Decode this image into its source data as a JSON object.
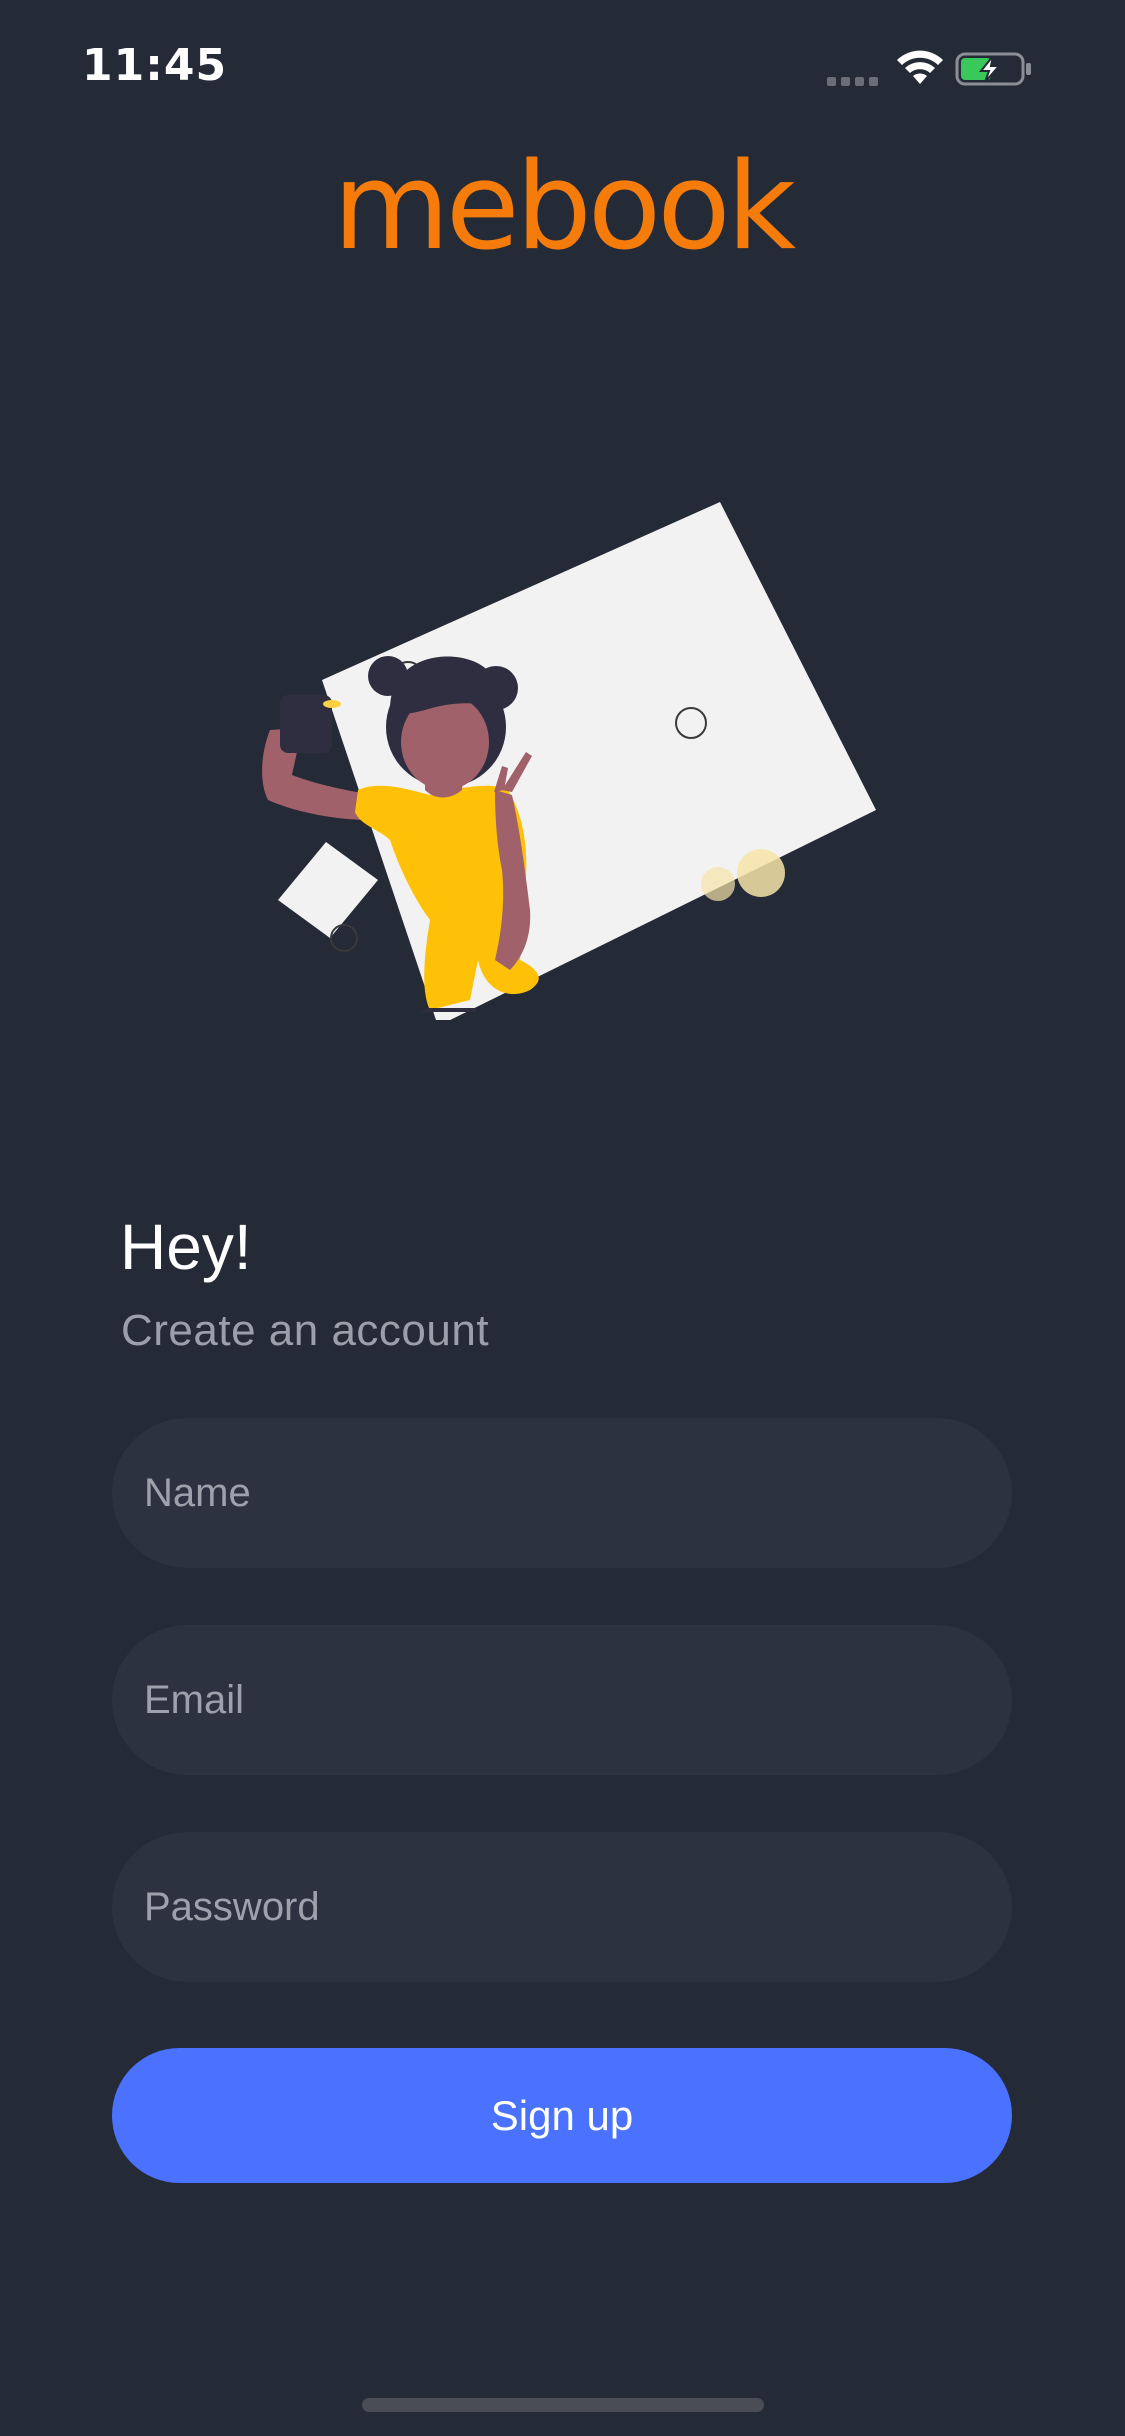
{
  "status_bar": {
    "time": "11:45",
    "icons": [
      "signal-dots-icon",
      "wifi-icon",
      "battery-charging-icon"
    ]
  },
  "brand": {
    "logo_text": "mebook",
    "color": "#f57c0b"
  },
  "illustration": {
    "description_icon": "selfie-illustration"
  },
  "greeting": {
    "title": "Hey!",
    "subtitle": "Create an account"
  },
  "form": {
    "name_placeholder": "Name",
    "email_placeholder": "Email",
    "password_placeholder": "Password",
    "name_value": "",
    "email_value": "",
    "password_value": "",
    "submit_label": "Sign up"
  },
  "colors": {
    "background": "#252a37",
    "field_background": "#2d3240",
    "button": "#4a72ff",
    "brand": "#f57c0b",
    "subtitle_text": "#9a9fa9"
  }
}
